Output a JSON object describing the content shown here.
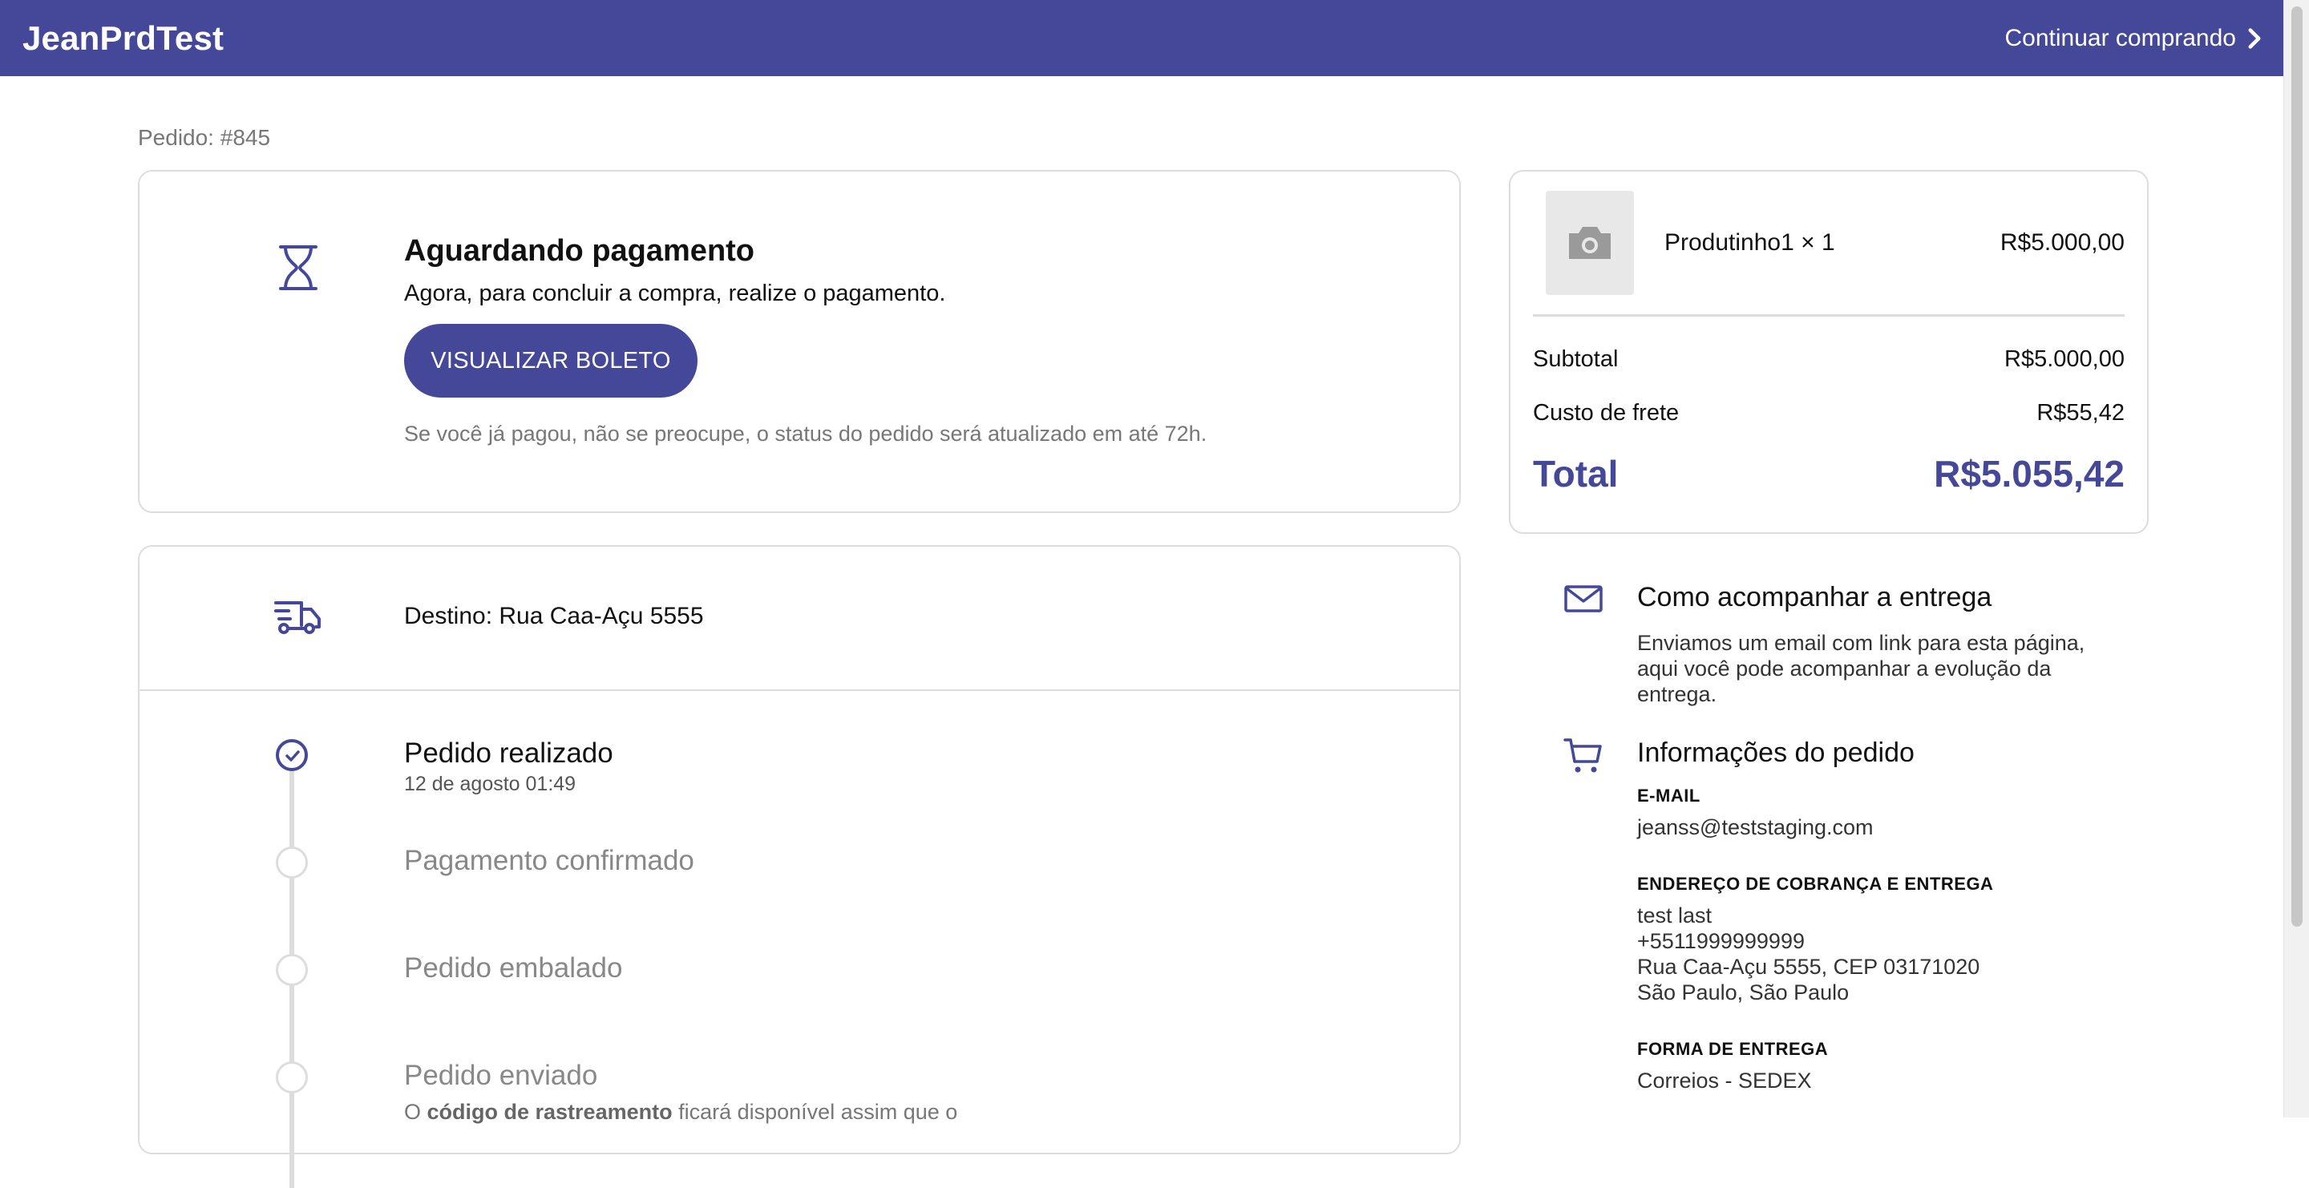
{
  "header": {
    "brand": "JeanPrdTest",
    "continue_label": "Continuar comprando"
  },
  "order": {
    "label": "Pedido: #845"
  },
  "payment": {
    "title": "Aguardando pagamento",
    "subtitle": "Agora, para concluir a compra, realize o pagamento.",
    "button_label": "VISUALIZAR BOLETO",
    "note": "Se você já pagou, não se preocupe, o status do pedido será atualizado em até 72h."
  },
  "shipping": {
    "destination": "Destino: Rua Caa-Açu 5555",
    "timeline": [
      {
        "title": "Pedido realizado",
        "date": "12 de agosto 01:49",
        "status": "done"
      },
      {
        "title": "Pagamento confirmado",
        "status": "pending"
      },
      {
        "title": "Pedido embalado",
        "status": "pending"
      },
      {
        "title": "Pedido enviado",
        "status": "pending"
      }
    ],
    "tracking_note": {
      "before": "O ",
      "bold": "código de rastreamento",
      "after": " ficará disponível assim que o"
    }
  },
  "summary": {
    "product_name": "Produtinho1 × 1",
    "product_price": "R$5.000,00",
    "subtotal_label": "Subtotal",
    "subtotal_value": "R$5.000,00",
    "shipping_label": "Custo de frete",
    "shipping_value": "R$55,42",
    "total_label": "Total",
    "total_value": "R$5.055,42"
  },
  "tracking_info": {
    "title": "Como acompanhar a entrega",
    "text": "Enviamos um email com link para esta página, aqui você pode acompanhar a evolução da entrega."
  },
  "order_info": {
    "title": "Informações do pedido",
    "email_label": "E-MAIL",
    "email_value": "jeanss@teststaging.com",
    "address_label": "ENDEREÇO DE COBRANÇA E ENTREGA",
    "address_lines": [
      "test last",
      "+5511999999999",
      "Rua Caa-Açu 5555, CEP 03171020",
      "São Paulo, São Paulo"
    ],
    "delivery_label": "FORMA DE ENTREGA",
    "delivery_value": "Correios - SEDEX"
  },
  "colors": {
    "brand": "#454899",
    "border": "#dddddd",
    "muted_text": "#777777"
  },
  "icons": [
    "chevron-right-icon",
    "hourglass-icon",
    "truck-icon",
    "check-icon",
    "camera-icon",
    "mail-icon",
    "cart-icon"
  ]
}
